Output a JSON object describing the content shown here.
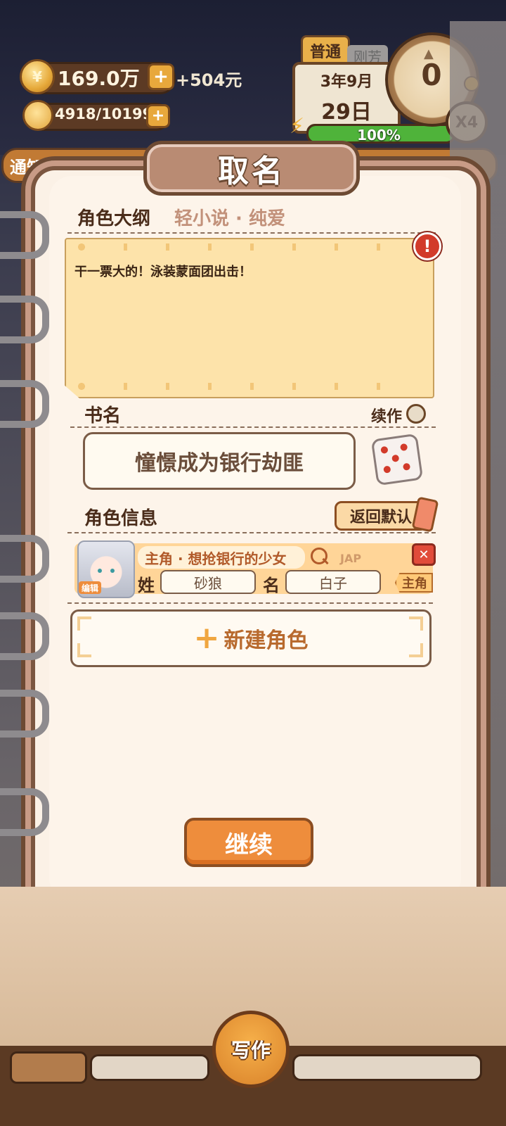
{
  "hud": {
    "money": "169.0万",
    "money_income": "+504元",
    "inspiration": "4918/10199",
    "difficulty": "普通",
    "hidden_tab": "刚芳",
    "date_year_month": "3年9月",
    "date_day": "29日",
    "energy_percent": "100%",
    "energy_fraction": 1.0,
    "dial_value": "0",
    "speed": "X4",
    "notice_label": "通知"
  },
  "dialog": {
    "title": "取名",
    "outline_label": "角色大纲",
    "outline_genre": "轻小说 · 纯爱",
    "outline_text": "干一票大的！泳装蒙面团出击！",
    "book_name_label": "书名",
    "sequel_label": "续作",
    "book_name": "憧憬成为银行劫匪",
    "character_info_label": "角色信息",
    "reset_default_label": "返回默认",
    "character": {
      "role_desc": "主角 · 想抢银行的少女",
      "lang": "JAP",
      "avatar_tag": "编辑",
      "surname_label": "姓",
      "surname": "砂狼",
      "given_label": "名",
      "given_name": "白子",
      "role_tag": "主角"
    },
    "new_character_label": "新建角色",
    "continue_label": "继续"
  },
  "bottom": {
    "write_label": "写作"
  },
  "colors": {
    "accent_orange": "#ee8d3c",
    "frame_brown": "#6d4a33",
    "paper_yellow": "#fde3aa",
    "energy_green": "#4fb33a",
    "alert_red": "#d23a2a"
  }
}
